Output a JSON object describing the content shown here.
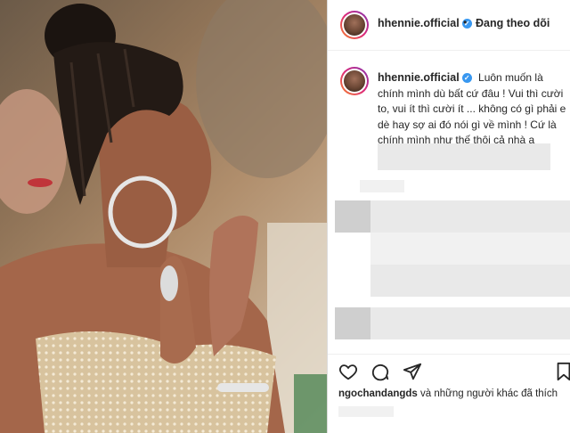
{
  "post": {
    "author": "hhennie.official",
    "verified_icon": "verified-check-icon",
    "follow_separator": "•",
    "follow_status": "Đang theo dõi",
    "caption": "Luôn muốn là chính mình dù bất cứ đâu ! Vui thì cười to, vui ít thì cười ít ... không có gì phải e dè hay sợ ai đó nói gì về mình ! Cứ là chính mình như thế thôi cả nhà ạ"
  },
  "actions": {
    "icons": [
      "heart-icon",
      "comment-icon",
      "share-icon",
      "bookmark-icon"
    ]
  },
  "likes": {
    "user": "ngochandangds",
    "text": " và những người khác đã thích"
  },
  "colors": {
    "verified": "#3897f0",
    "text": "#262626",
    "divider": "#efefef"
  }
}
